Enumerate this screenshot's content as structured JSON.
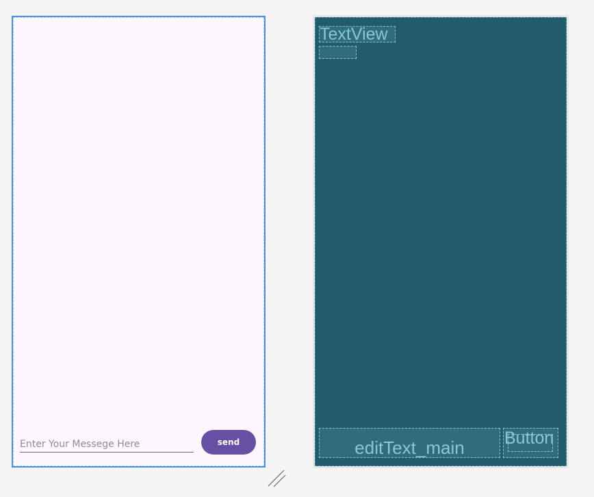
{
  "design": {
    "input_placeholder": "Enter Your Messege Here",
    "send_label": "send",
    "button_color": "#6750a4",
    "background_color": "#fef7ff",
    "selection_color": "#4a90e2"
  },
  "blueprint": {
    "background_color": "#235b6d",
    "outline_color": "#7fc7d4",
    "textview_label": "TextView",
    "edittext_label": "editText_main",
    "button_label": "Button"
  },
  "icons": {
    "resize_handle": "resize-handle-icon"
  }
}
